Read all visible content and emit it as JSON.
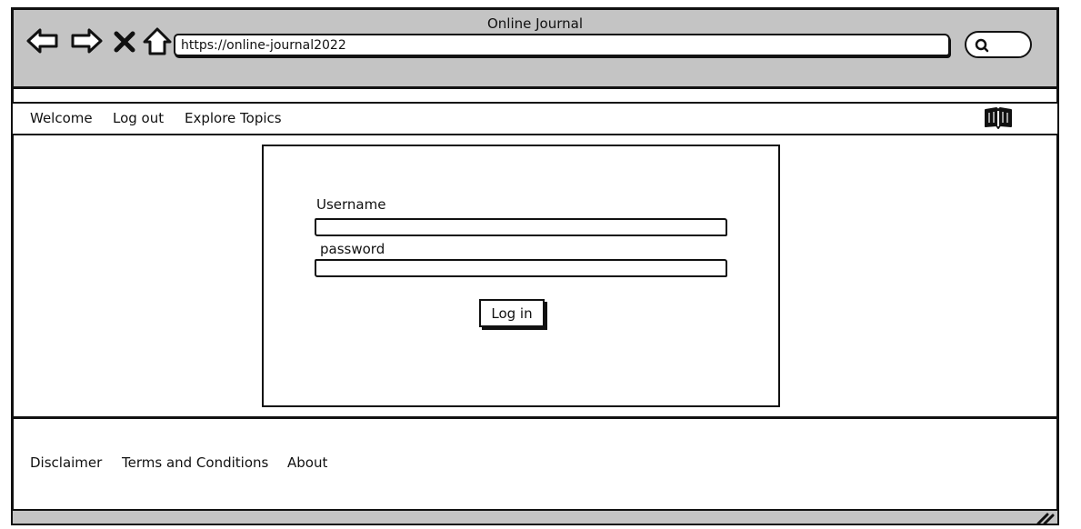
{
  "browser": {
    "title": "Online Journal",
    "url": "https://online-journal2022"
  },
  "nav": {
    "items": [
      {
        "label": "Welcome"
      },
      {
        "label": "Log out"
      },
      {
        "label": "Explore Topics"
      }
    ]
  },
  "login": {
    "username_label": "Username",
    "username_value": "",
    "password_label": "password",
    "password_value": "",
    "submit_label": "Log in"
  },
  "footer": {
    "links": [
      {
        "label": "Disclaimer"
      },
      {
        "label": "Terms and Conditions"
      },
      {
        "label": "About"
      }
    ]
  },
  "icons": {
    "back": "arrow-left-icon",
    "forward": "arrow-right-icon",
    "stop": "close-icon",
    "home": "home-icon",
    "search": "search-icon",
    "brand": "book-icon",
    "resize": "resize-grip-icon"
  },
  "colors": {
    "chrome": "#c4c4c4",
    "stroke": "#111111",
    "background": "#ffffff"
  }
}
